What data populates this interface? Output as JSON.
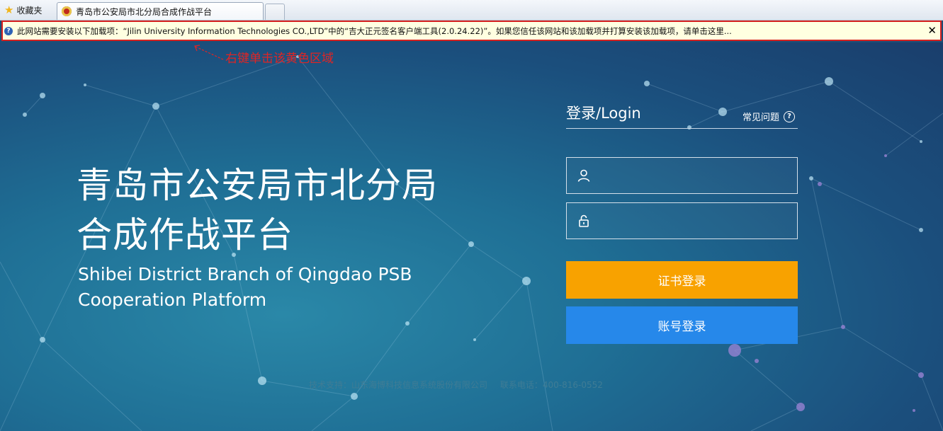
{
  "browser": {
    "favorites_label": "收藏夹",
    "tab_title": "青岛市公安局市北分局合成作战平台",
    "infobar_text": "此网站需要安装以下加载项：“Jilin University Information Technologies CO.,LTD”中的“吉大正元签名客户端工具(2.0.24.22)”。如果您信任该网站和该加载项并打算安装该加载项，请单击这里...",
    "infobar_close": "✕"
  },
  "annotation": {
    "text": "右键单击该黄色区域",
    "color": "#e02424"
  },
  "hero": {
    "title_line1": "青岛市公安局市北分局",
    "title_line2": "合成作战平台",
    "subtitle_line1": "Shibei District Branch of Qingdao PSB",
    "subtitle_line2": "Cooperation Platform"
  },
  "login": {
    "title": "登录/Login",
    "faq_label": "常见问题",
    "faq_icon": "?",
    "username_placeholder": "",
    "password_placeholder": "",
    "cert_button": "证书登录",
    "account_button": "账号登录",
    "cert_color": "#f8a200",
    "account_color": "#2688ea"
  },
  "footer": {
    "support": "技术支持：山东海博科技信息系统股份有限公司",
    "phone": "联系电话：400-816-0552"
  }
}
